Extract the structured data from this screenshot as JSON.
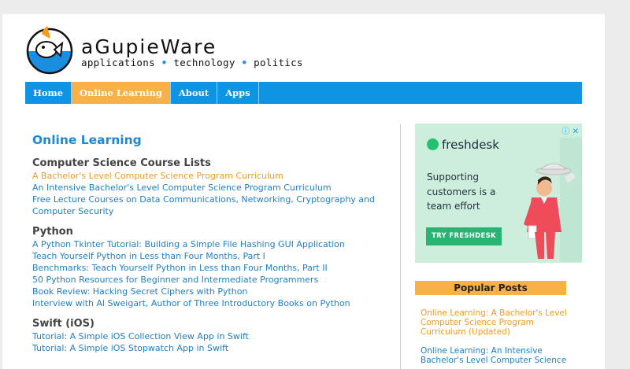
{
  "site": {
    "title": "aGupieWare",
    "tagline": [
      "applications",
      "technology",
      "politics"
    ],
    "tagline_separator": "•"
  },
  "nav": [
    {
      "label": "Home",
      "active": false
    },
    {
      "label": "Online Learning",
      "active": true
    },
    {
      "label": "About",
      "active": false
    },
    {
      "label": "Apps",
      "active": false
    }
  ],
  "main": {
    "title": "Online Learning",
    "sections": [
      {
        "heading": "Computer Science Course Lists",
        "links": [
          {
            "text": "A Bachelor's Level Computer Science Program Curriculum",
            "visited": true
          },
          {
            "text": "An Intensive Bachelor's Level Computer Science Program Curriculum",
            "visited": false
          },
          {
            "text": "Free Lecture Courses on Data Communications, Networking, Cryptography and Computer Security",
            "visited": false
          }
        ]
      },
      {
        "heading": "Python",
        "links": [
          {
            "text": "A Python Tkinter Tutorial: Building a Simple File Hashing GUI Application",
            "visited": false
          },
          {
            "text": "Teach Yourself Python in Less than Four Months, Part I",
            "visited": false
          },
          {
            "text": "Benchmarks: Teach Yourself Python in Less than Four Months, Part II",
            "visited": false
          },
          {
            "text": "50 Python Resources for Beginner and Intermediate Programmers",
            "visited": false
          },
          {
            "text": "Book Review: Hacking Secret Ciphers with Python",
            "visited": false
          },
          {
            "text": "Interview with Al Sweigart, Author of Three Introductory Books on Python",
            "visited": false
          }
        ]
      },
      {
        "heading": "Swift (iOS)",
        "links": [
          {
            "text": "Tutorial: A Simple iOS Collection View App in Swift",
            "visited": false
          },
          {
            "text": "Tutorial: A Simple iOS Stopwatch App in Swift",
            "visited": false
          }
        ]
      }
    ]
  },
  "ad": {
    "brand": "freshdesk",
    "copy": "Supporting customers is a team effort",
    "cta": "TRY FRESHDESK",
    "close_glyphs": "ⓘ ✕"
  },
  "popular_posts": {
    "heading": "Popular Posts",
    "items": [
      {
        "text": "Online Learning: A Bachelor's Level Computer Science Program Curriculum (Updated)",
        "color": "#f39a1a"
      },
      {
        "text": "Online Learning: An Intensive Bachelor's Level Computer Science",
        "color": "#1e7fc7"
      }
    ]
  },
  "colors": {
    "nav_bg": "#0f93e3",
    "nav_active": "#f7b146",
    "link": "#1e7fc7",
    "visited_link": "#f39a1a",
    "heading_blue": "#1e88d2"
  }
}
